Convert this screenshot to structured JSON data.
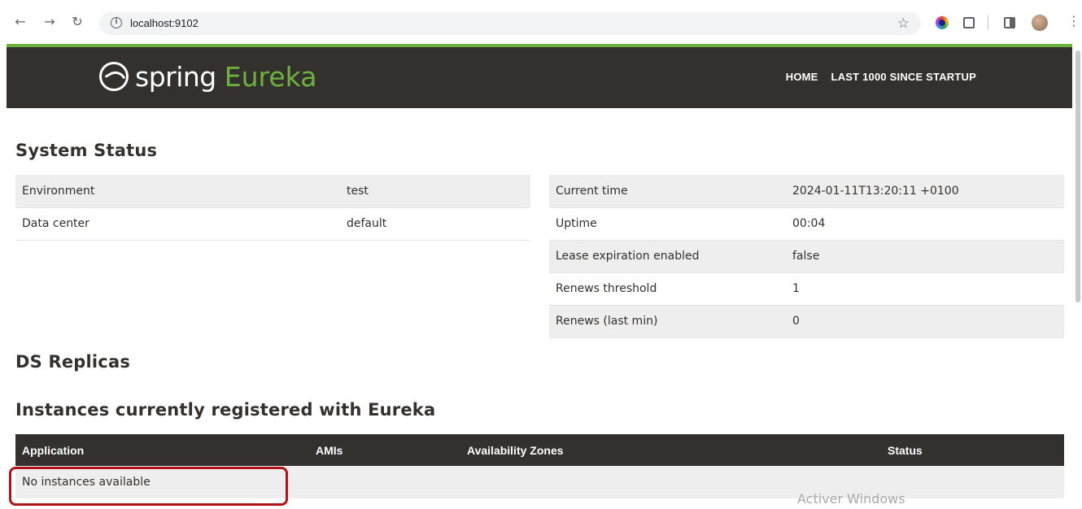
{
  "browser": {
    "url": "localhost:9102"
  },
  "header": {
    "logo_spring": "spring",
    "logo_eureka": "Eureka",
    "nav": [
      {
        "label": "HOME"
      },
      {
        "label": "LAST 1000 SINCE STARTUP"
      }
    ]
  },
  "system_status": {
    "title": "System Status",
    "left": [
      {
        "key": "Environment",
        "value": "test"
      },
      {
        "key": "Data center",
        "value": "default"
      }
    ],
    "right": [
      {
        "key": "Current time",
        "value": "2024-01-11T13:20:11 +0100"
      },
      {
        "key": "Uptime",
        "value": "00:04"
      },
      {
        "key": "Lease expiration enabled",
        "value": "false"
      },
      {
        "key": "Renews threshold",
        "value": "1"
      },
      {
        "key": "Renews (last min)",
        "value": "0"
      }
    ]
  },
  "ds_replicas": {
    "title": "DS Replicas"
  },
  "instances": {
    "title": "Instances currently registered with Eureka",
    "columns": [
      "Application",
      "AMIs",
      "Availability Zones",
      "Status"
    ],
    "empty_message": "No instances available"
  },
  "watermark": "Activer Windows",
  "colors": {
    "brand_green": "#6db33f",
    "header_dark": "#34302d",
    "highlight_red": "#b0121a"
  }
}
